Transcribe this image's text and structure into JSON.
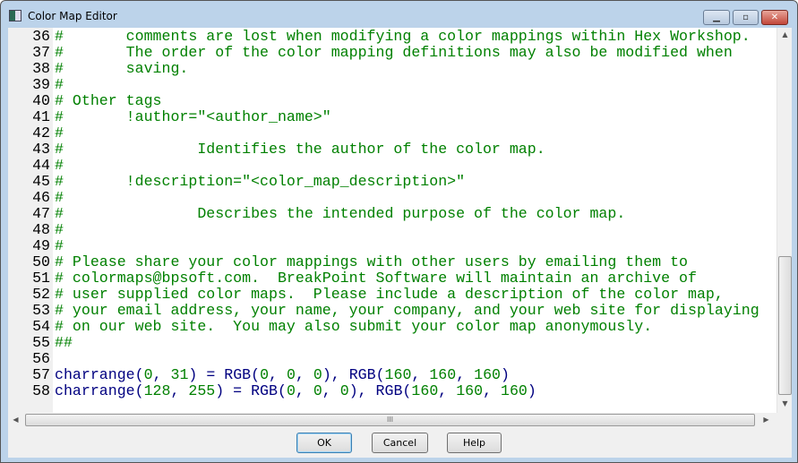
{
  "window": {
    "title": "Color Map Editor",
    "minimize": "▁",
    "maximize": "▫",
    "close": "✕"
  },
  "editor": {
    "comment_lines": [
      {
        "n": "36",
        "text": "#       comments are lost when modifying a color mappings within Hex Workshop."
      },
      {
        "n": "37",
        "text": "#       The order of the color mapping definitions may also be modified when"
      },
      {
        "n": "38",
        "text": "#       saving."
      },
      {
        "n": "39",
        "text": "#"
      },
      {
        "n": "40",
        "text": "# Other tags"
      },
      {
        "n": "41",
        "text": "#       !author=\"<author_name>\""
      },
      {
        "n": "42",
        "text": "#"
      },
      {
        "n": "43",
        "text": "#               Identifies the author of the color map."
      },
      {
        "n": "44",
        "text": "#"
      },
      {
        "n": "45",
        "text": "#       !description=\"<color_map_description>\""
      },
      {
        "n": "46",
        "text": "#"
      },
      {
        "n": "47",
        "text": "#               Describes the intended purpose of the color map."
      },
      {
        "n": "48",
        "text": "#"
      },
      {
        "n": "49",
        "text": "#"
      },
      {
        "n": "50",
        "text": "# Please share your color mappings with other users by emailing them to"
      },
      {
        "n": "51",
        "text": "# colormaps@bpsoft.com.  BreakPoint Software will maintain an archive of"
      },
      {
        "n": "52",
        "text": "# user supplied color maps.  Please include a description of the color map,"
      },
      {
        "n": "53",
        "text": "# your email address, your name, your company, and your web site for displaying"
      },
      {
        "n": "54",
        "text": "# on our web site.  You may also submit your color map anonymously."
      },
      {
        "n": "55",
        "text": "##"
      },
      {
        "n": "56",
        "text": ""
      }
    ],
    "code_lines": [
      {
        "n": "57",
        "a": "charrange(",
        "b": "0",
        "c": ", ",
        "d": "31",
        "e": ") = RGB(",
        "f": "0",
        "g": ", ",
        "h": "0",
        "i": ", ",
        "j": "0",
        "k": "), RGB(",
        "l": "160",
        "m": ", ",
        "o": "160",
        "p": ", ",
        "q": "160",
        "r": ")"
      },
      {
        "n": "58",
        "a": "charrange(",
        "b": "128",
        "c": ", ",
        "d": "255",
        "e": ") = RGB(",
        "f": "0",
        "g": ", ",
        "h": "0",
        "i": ", ",
        "j": "0",
        "k": "), RGB(",
        "l": "160",
        "m": ", ",
        "o": "160",
        "p": ", ",
        "q": "160",
        "r": ")"
      }
    ]
  },
  "buttons": {
    "ok": "OK",
    "cancel": "Cancel",
    "help": "Help"
  },
  "hscroll_grip": "III",
  "colors": {
    "comment": "#008000",
    "keyword": "#000080",
    "number": "#008000"
  }
}
